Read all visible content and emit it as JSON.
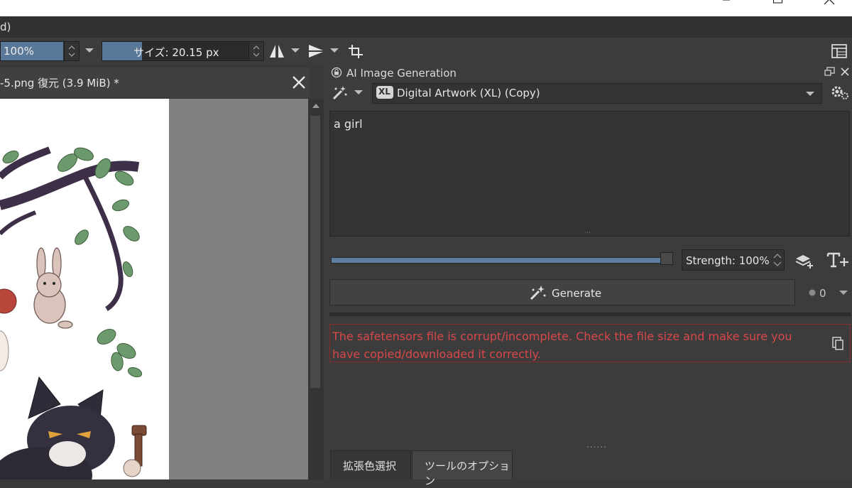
{
  "menu": {
    "partial": "d)"
  },
  "toolbar": {
    "zoom": "100%",
    "size": "サイズ: 20.15 px"
  },
  "document": {
    "tab_title": "-5.png 復元 (3.9 MiB) *"
  },
  "ai_panel": {
    "title": "AI Image Generation",
    "model_badge": "XL",
    "model": "Digital Artwork (XL) (Copy)",
    "prompt": "a girl",
    "strength_label": "Strength: 100%",
    "strength": 1.0,
    "generate_label": "Generate",
    "queue_count": "0",
    "error": "The safetensors file is corrupt/incomplete. Check the file size and make sure you have copied/downloaded it correctly."
  },
  "bottom_tabs": [
    "拡張色選択",
    "ツールのオプション"
  ],
  "colors": {
    "accent": "#5a7898",
    "error": "#d8474a",
    "panel": "#3c3c3c"
  }
}
